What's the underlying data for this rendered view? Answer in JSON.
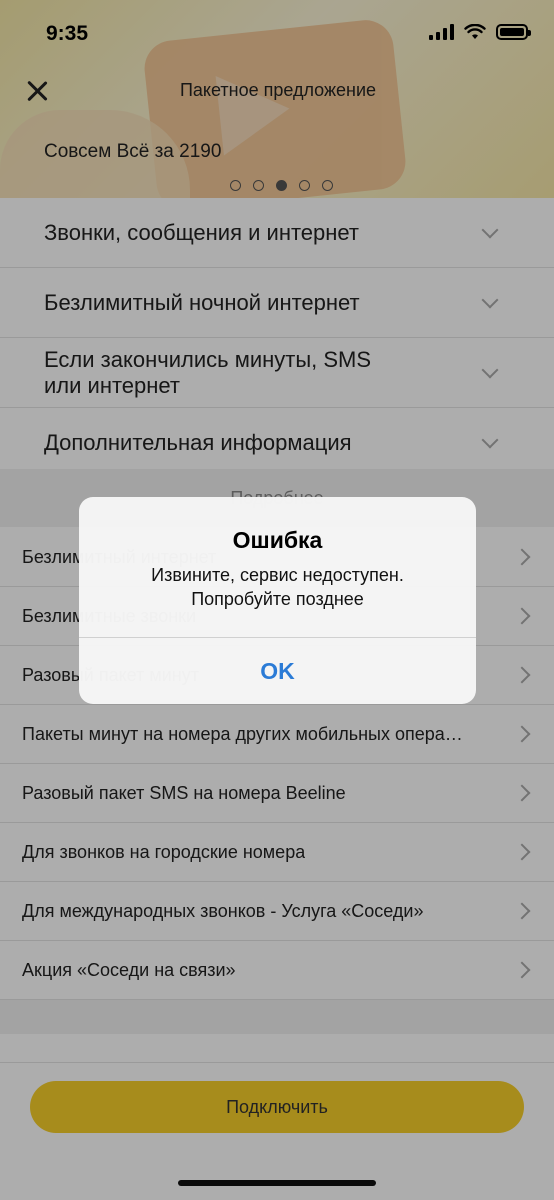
{
  "status_bar": {
    "time": "9:35"
  },
  "header": {
    "title": "Пакетное предложение",
    "offer_title": "Совсем Всё за 2190",
    "carousel_total": 5,
    "carousel_active": 3
  },
  "accordion": [
    {
      "label": "Звонки, сообщения и интернет"
    },
    {
      "label": "Безлимитный ночной интернет"
    },
    {
      "label": "Если закончились минуты, SMS или интернет"
    },
    {
      "label": "Дополнительная информация"
    }
  ],
  "section": {
    "label": "Подробнее"
  },
  "list": [
    {
      "label": "Безлимитный интернет"
    },
    {
      "label": "Безлимитные звонки"
    },
    {
      "label": "Разовый пакет минут"
    },
    {
      "label": "Пакеты минут на номера других мобильных опера…"
    },
    {
      "label": "Разовый пакет SMS на номера Beeline"
    },
    {
      "label": "Для звонков на городские номера"
    },
    {
      "label": "Для международных звонков - Услуга «Соседи»"
    },
    {
      "label": "Акция «Соседи на связи»"
    }
  ],
  "connect_button": {
    "label": "Подключить"
  },
  "alert": {
    "title": "Ошибка",
    "message_line1": "Извините, сервис недоступен.",
    "message_line2": "Попробуйте позднее",
    "ok_label": "OK"
  },
  "colors": {
    "accent_yellow": "#f7cf2a",
    "alert_button_blue": "#2b7bd6"
  }
}
